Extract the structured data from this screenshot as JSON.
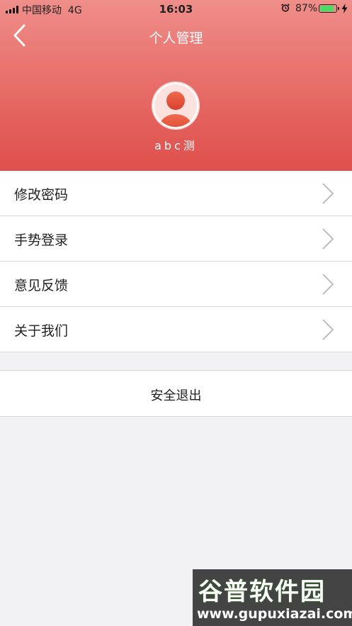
{
  "status_bar": {
    "carrier": "中国移动",
    "network": "4G",
    "time": "16:03",
    "battery_percent": "87%",
    "battery_level": 0.87
  },
  "nav": {
    "title": "个人管理",
    "back_icon": "chevron-left-icon"
  },
  "profile": {
    "username": "abc测",
    "avatar_icon": "user-avatar-icon"
  },
  "menu": {
    "items": [
      {
        "label": "修改密码",
        "icon": "chevron-right-icon"
      },
      {
        "label": "手势登录",
        "icon": "chevron-right-icon"
      },
      {
        "label": "意见反馈",
        "icon": "chevron-right-icon"
      },
      {
        "label": "关于我们",
        "icon": "chevron-right-icon"
      }
    ]
  },
  "logout": {
    "label": "安全退出"
  },
  "watermark": {
    "name": "谷普软件园",
    "url": "www.gupuxiazai.com"
  },
  "colors": {
    "header_top": "#ef8e8a",
    "header_bottom": "#de4f4b",
    "avatar": "#e0503a",
    "battery": "#4cd964"
  }
}
